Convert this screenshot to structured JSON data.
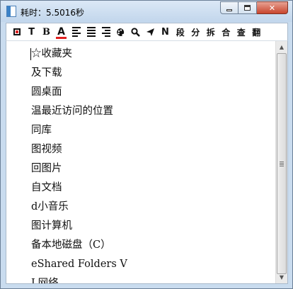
{
  "window": {
    "title": "耗时：5.5016秒",
    "close_glyph": "✕"
  },
  "toolbar": {
    "text_tool": "T",
    "bold_tool": "B",
    "font_color_tool": "A",
    "labels": [
      "段",
      "分",
      "拆",
      "合",
      "查",
      "翻"
    ],
    "n_label": "N"
  },
  "content": {
    "items": [
      "☆收藏夹",
      "及下载",
      "圆桌面",
      "温最近访问的位置",
      "同库",
      "图视频",
      "回图片",
      "自文档",
      "d小音乐",
      "图计算机",
      "备本地磁盘（C）",
      "eShared Folders V",
      "L网络"
    ]
  },
  "colors": {
    "accent": "#e02020",
    "titlebar": "#c9dcef"
  }
}
